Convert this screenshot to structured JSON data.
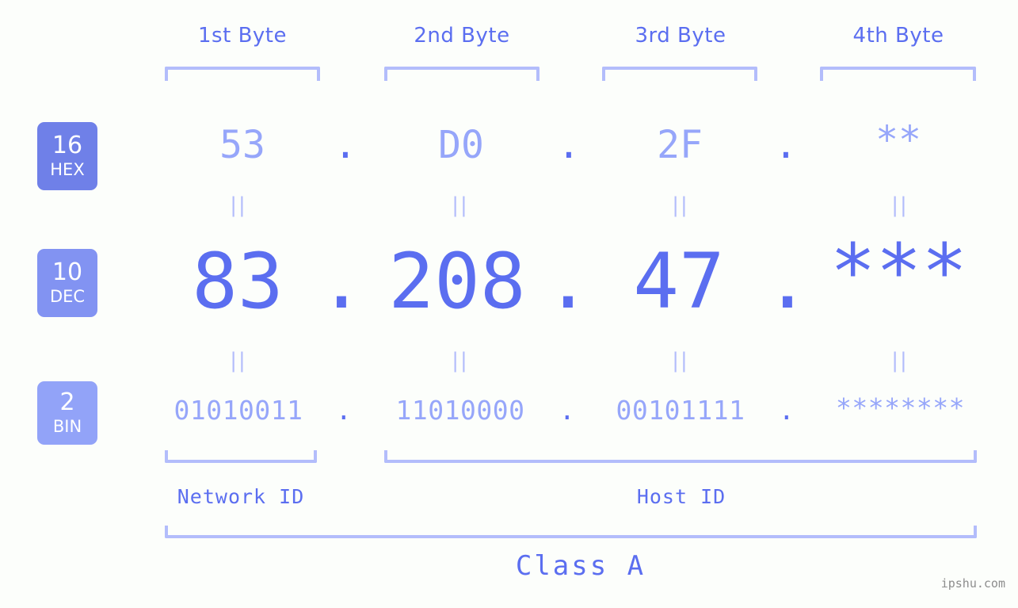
{
  "meta": {
    "watermark": "ipshu.com"
  },
  "byte_headers": [
    {
      "label": "1st Byte"
    },
    {
      "label": "2nd Byte"
    },
    {
      "label": "3rd Byte"
    },
    {
      "label": "4th Byte"
    }
  ],
  "bases": [
    {
      "radix": "16",
      "name": "HEX",
      "color": "#6f80e8"
    },
    {
      "radix": "10",
      "name": "DEC",
      "color": "#8293f2"
    },
    {
      "radix": "2",
      "name": "BIN",
      "color": "#92a3f8"
    }
  ],
  "separator": ".",
  "equals_symbol": "||",
  "rows": {
    "hex": {
      "values": [
        "53",
        "D0",
        "2F",
        "**"
      ]
    },
    "dec": {
      "values": [
        "83",
        "208",
        "47",
        "***"
      ]
    },
    "bin": {
      "values": [
        "01010011",
        "11010000",
        "00101111",
        "********"
      ]
    }
  },
  "id_sections": [
    {
      "label": "Network ID"
    },
    {
      "label": "Host ID"
    }
  ],
  "class_label": "Class A",
  "colors": {
    "background": "#fcfefb",
    "accent_strong": "#5b6ef0",
    "accent_light": "#96a6fa",
    "bracket": "#b3bdfb",
    "badge_hex": "#6f80e8",
    "badge_dec": "#8293f2",
    "badge_bin": "#92a3f8",
    "watermark": "#8d8d8d"
  }
}
